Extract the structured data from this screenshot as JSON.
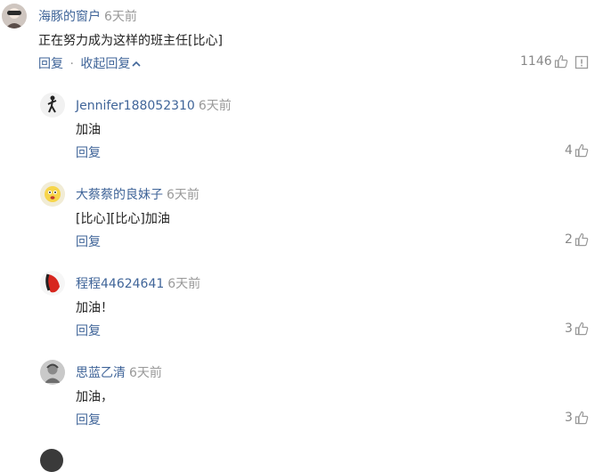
{
  "main_comment": {
    "user": "海豚的窗户",
    "time": "6天前",
    "text": "正在努力成为这样的班主任[比心]",
    "reply_label": "回复",
    "separator": "·",
    "collapse_label": "收起回复",
    "likes": "1146"
  },
  "replies": [
    {
      "user": "Jennifer188052310",
      "time": "6天前",
      "text": "加油",
      "reply_label": "回复",
      "likes": "4"
    },
    {
      "user": "大蔡蔡的良妹子",
      "time": "6天前",
      "text": "[比心][比心]加油",
      "reply_label": "回复",
      "likes": "2"
    },
    {
      "user": "程程44624641",
      "time": "6天前",
      "text": "加油！",
      "reply_label": "回复",
      "likes": "3"
    },
    {
      "user": "思蓝乙清",
      "time": "6天前",
      "text": "加油，",
      "reply_label": "回复",
      "likes": "3"
    }
  ],
  "colors": {
    "link": "#406599",
    "muted": "#999999",
    "text": "#222222",
    "icon": "#9a9a9a"
  },
  "icons": {
    "like": "thumbs-up-icon",
    "report": "report-icon",
    "collapse": "chevron-up-icon"
  }
}
